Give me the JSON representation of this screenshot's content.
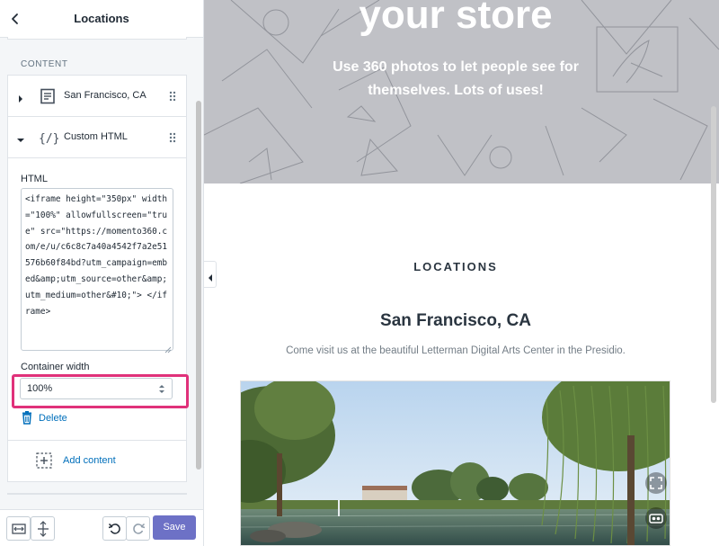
{
  "sidebar": {
    "title": "Locations",
    "section_label": "CONTENT",
    "items": [
      {
        "label": "San Francisco, CA",
        "icon": "text-block-icon",
        "expanded": false
      },
      {
        "label": "Custom HTML",
        "icon": "code-braces-icon",
        "expanded": true
      }
    ],
    "html_field": {
      "label": "HTML",
      "value": "<iframe height=\"350px\" width=\"100%\" allowfullscreen=\"true\" src=\"https://momento360.com/e/u/c6c8c7a40a4542f7a2e51576b60f84bd?utm_campaign=embed&amp;utm_source=other&amp;utm_medium=other&#10;\"> </iframe>"
    },
    "container_width": {
      "label": "Container width",
      "value": "100%"
    },
    "delete_label": "Delete",
    "add_content_label": "Add content",
    "footer": {
      "save_label": "Save"
    }
  },
  "preview": {
    "hero": {
      "headline": "your store",
      "subtext": "Use 360 photos to let people see for themselves. Lots of uses!"
    },
    "locations": {
      "heading": "LOCATIONS",
      "title": "San Francisco, CA",
      "description": "Come visit us at the beautiful Letterman Digital Arts Center in the Presidio."
    }
  },
  "colors": {
    "accent": "#6d71c6",
    "link": "#006fbb",
    "highlight": "#e0317a",
    "hero_bg": "#c0c1c6"
  }
}
